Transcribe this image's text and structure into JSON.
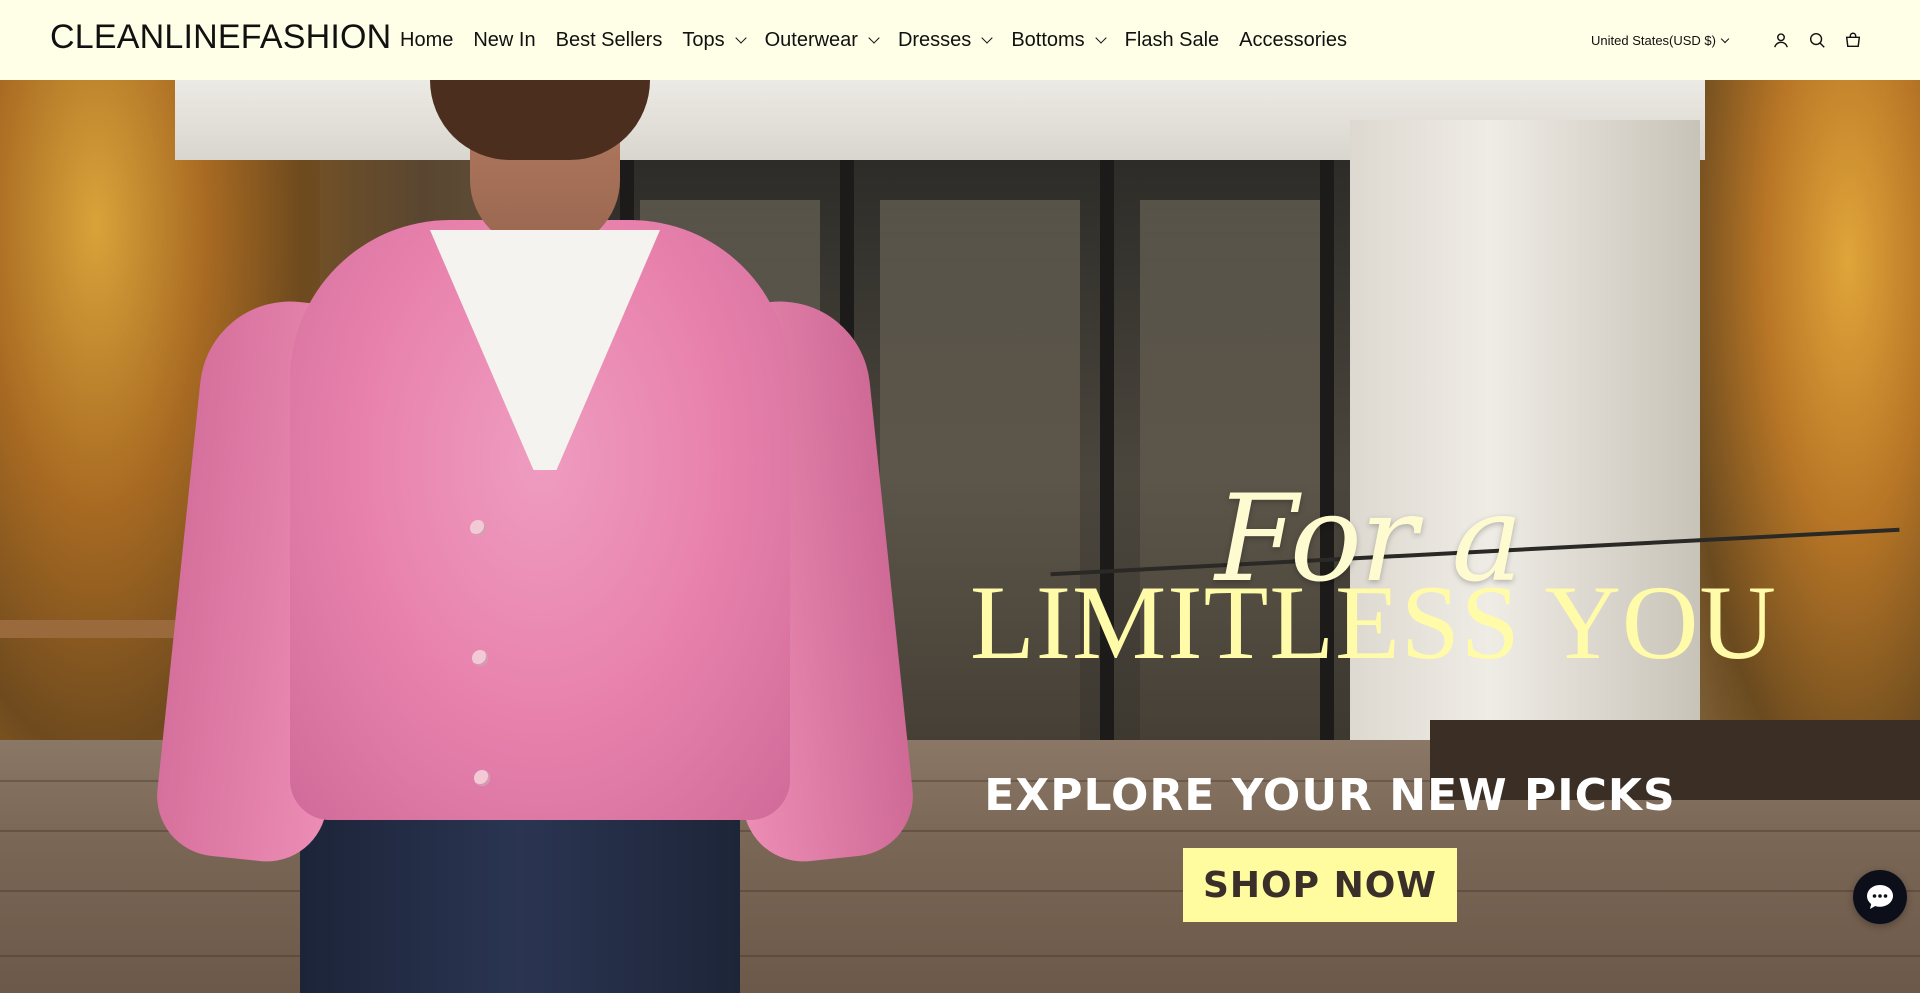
{
  "header": {
    "logo": "CLEANLINEFASHION",
    "nav": [
      {
        "label": "Home",
        "dropdown": false
      },
      {
        "label": "New In",
        "dropdown": false
      },
      {
        "label": "Best Sellers",
        "dropdown": false
      },
      {
        "label": "Tops",
        "dropdown": true
      },
      {
        "label": "Outerwear",
        "dropdown": true
      },
      {
        "label": "Dresses",
        "dropdown": true
      },
      {
        "label": "Bottoms",
        "dropdown": true
      },
      {
        "label": "Flash Sale",
        "dropdown": false
      },
      {
        "label": "Accessories",
        "dropdown": false
      }
    ],
    "locale": "United States(USD $)",
    "icons": [
      "account-icon",
      "search-icon",
      "cart-icon"
    ],
    "background": "#fffee6"
  },
  "hero": {
    "script_text": "For a",
    "headline": "LIMITLESS YOU",
    "subheadline": "EXPLORE YOUR NEW PICKS",
    "cta_label": "SHOP NOW",
    "headline_color": "#fffba8",
    "cta_color": "#fffb9f"
  },
  "chat": {
    "icon": "chat-icon",
    "color": "#0c0f1a"
  }
}
